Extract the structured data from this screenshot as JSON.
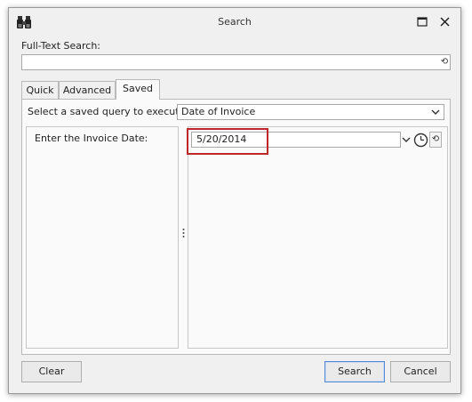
{
  "window": {
    "title": "Search",
    "icon": "binoculars-icon"
  },
  "fulltext": {
    "label": "Full-Text Search:",
    "value": ""
  },
  "tabs": [
    {
      "label": "Quick",
      "active": false
    },
    {
      "label": "Advanced",
      "active": false
    },
    {
      "label": "Saved",
      "active": true
    }
  ],
  "saved": {
    "query_label": "Select a saved query to execute:",
    "query_value": "Date of Invoice",
    "param_label": "Enter the Invoice Date:",
    "date_value": "5/20/2014"
  },
  "buttons": {
    "clear": "Clear",
    "search": "Search",
    "cancel": "Cancel"
  },
  "colors": {
    "highlight": "#c0272d",
    "default_button_border": "#5a8ad3"
  }
}
